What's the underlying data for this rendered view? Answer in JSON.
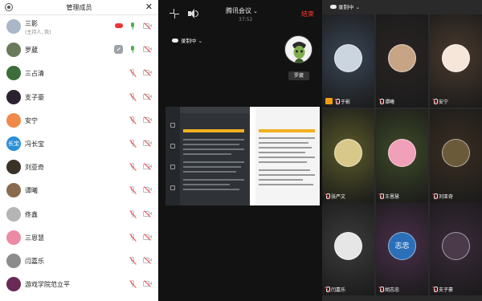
{
  "left_panel": {
    "title": "管理成员",
    "members": [
      {
        "name": "三影",
        "sub": "(主持人, 我)",
        "mic": "on",
        "cam": "off",
        "avatar_color": "#a9b7c8"
      },
      {
        "name": "罗葳",
        "mic": "on",
        "cam": "off",
        "avatar_color": "#6b7a5a"
      },
      {
        "name": "三占清",
        "mic": "off",
        "cam": "off",
        "avatar_color": "#3c6e3a"
      },
      {
        "name": "支子豪",
        "mic": "off",
        "cam": "off",
        "avatar_color": "#2b2230"
      },
      {
        "name": "安宁",
        "mic": "off",
        "cam": "off",
        "avatar_color": "#f08a4b"
      },
      {
        "name": "冯长宝",
        "mic": "off",
        "cam": "off",
        "avatar_color": "#2c8fd6",
        "avatar_text": "长宝"
      },
      {
        "name": "刘亚奇",
        "mic": "off",
        "cam": "off",
        "avatar_color": "#3a3225"
      },
      {
        "name": "谭曦",
        "mic": "off",
        "cam": "off",
        "avatar_color": "#8a6a4f"
      },
      {
        "name": "佟鑫",
        "mic": "off",
        "cam": "off",
        "avatar_color": "#b5b5b5"
      },
      {
        "name": "三恩慧",
        "mic": "off",
        "cam": "off",
        "avatar_color": "#ec8aa6"
      },
      {
        "name": "闫嘉乐",
        "mic": "off",
        "cam": "off",
        "avatar_color": "#8c8c8c"
      },
      {
        "name": "游戏学院范立平",
        "mic": "off",
        "cam": "off",
        "avatar_color": "#6a2a55"
      }
    ]
  },
  "mid_panel": {
    "meeting_title": "腾讯会议",
    "meeting_time": "37:52",
    "end_label": "结束",
    "recording_label": "录制中",
    "speaker_name": "罗葳"
  },
  "right_panel": {
    "recording_label": "录制中",
    "tiles": [
      {
        "name": "于影",
        "bg": "#3a4656",
        "ava": "#cbd5e0",
        "host": true
      },
      {
        "name": "谭曦",
        "bg": "#2a2424",
        "ava": "#c7a486"
      },
      {
        "name": "安宁",
        "bg": "#4a3a2e",
        "ava": "#f6e6da"
      },
      {
        "name": "张严文",
        "bg": "#5a5a2a",
        "ava": "#d8c98a"
      },
      {
        "name": "王恩慧",
        "bg": "#3e4a28",
        "ava": "#f0a0b8"
      },
      {
        "name": "刘亚奇",
        "bg": "#3a2e22",
        "ava": "#6a5a3a"
      },
      {
        "name": "闫嘉乐",
        "bg": "#3c3c3c",
        "ava": "#e6e6e6"
      },
      {
        "name": "胡志忠",
        "bg": "#4a2f4a",
        "ava": "#2a6fb8",
        "ava_text": "志忠"
      },
      {
        "name": "支子豪",
        "bg": "#3a2a3a",
        "ava": "#4a3a4a"
      }
    ],
    "page_dots": 4,
    "active_dot": 1
  }
}
